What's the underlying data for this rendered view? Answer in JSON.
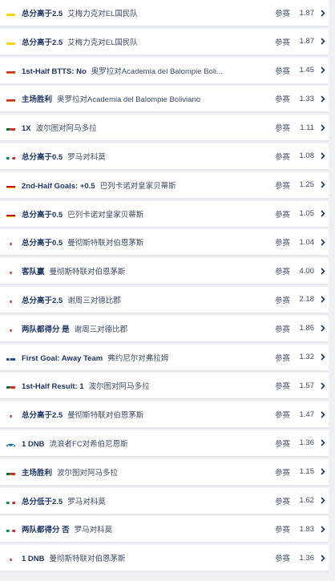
{
  "bets": [
    {
      "flag": "co",
      "market": "总分高于2.5",
      "event": "艾梅力克对EL国民队",
      "join": "参赛",
      "odds": "1.87"
    },
    {
      "flag": "co",
      "market": "总分高于2.5",
      "event": "艾梅力克对EL国民队",
      "join": "参赛",
      "odds": "1.87"
    },
    {
      "flag": "bo",
      "market": "1st-Half BTTS: No",
      "event": "奥罗拉对Academia del Balompie Boli...",
      "join": "参赛",
      "odds": "1.45"
    },
    {
      "flag": "bo",
      "market": "主场胜利",
      "event": "奥罗拉对Academia del Balompie Boliviano",
      "join": "参赛",
      "odds": "1.33"
    },
    {
      "flag": "pt",
      "market": "1X",
      "event": "波尔图对阿马多拉",
      "join": "参赛",
      "odds": "1.11"
    },
    {
      "flag": "it",
      "market": "总分高于0.5",
      "event": "罗马对科莫",
      "join": "参赛",
      "odds": "1.08"
    },
    {
      "flag": "es",
      "market": "2nd-Half Goals: +0.5",
      "event": "巴列卡诺对皇家贝蒂斯",
      "join": "参赛",
      "odds": "1.25"
    },
    {
      "flag": "es",
      "market": "总分高于0.5",
      "event": "巴列卡诺对皇家贝蒂斯",
      "join": "参赛",
      "odds": "1.05"
    },
    {
      "flag": "en",
      "market": "总分高于0.5",
      "event": "曼彻斯特联对伯恩茅斯",
      "join": "参赛",
      "odds": "1.04"
    },
    {
      "flag": "en",
      "market": "客队赢",
      "event": "曼彻斯特联对伯恩茅斯",
      "join": "参赛",
      "odds": "4.00"
    },
    {
      "flag": "en",
      "market": "总分高于2.5",
      "event": "谢周三对德比郡",
      "join": "参赛",
      "odds": "2.18"
    },
    {
      "flag": "en",
      "market": "两队都得分 是",
      "event": "谢周三对德比郡",
      "join": "参赛",
      "odds": "1.86"
    },
    {
      "flag": "is",
      "market": "First Goal: Away Team",
      "event": "弗约尼尔对弗拉姆",
      "join": "参赛",
      "odds": "1.32"
    },
    {
      "flag": "pt",
      "market": "1st-Half Result: 1",
      "event": "波尔图对阿马多拉",
      "join": "参赛",
      "odds": "1.57"
    },
    {
      "flag": "en",
      "market": "总分高于2.5",
      "event": "曼彻斯特联对伯恩茅斯",
      "join": "参赛",
      "odds": "1.47"
    },
    {
      "flag": "sc",
      "market": "1 DNB",
      "event": "流浪者FC对希伯尼恩斯",
      "join": "参赛",
      "odds": "1.36"
    },
    {
      "flag": "pt",
      "market": "主场胜利",
      "event": "波尔图对阿马多拉",
      "join": "参赛",
      "odds": "1.15"
    },
    {
      "flag": "it",
      "market": "总分低于2.5",
      "event": "罗马对科莫",
      "join": "参赛",
      "odds": "1.62"
    },
    {
      "flag": "it",
      "market": "两队都得分 否",
      "event": "罗马对科莫",
      "join": "参赛",
      "odds": "1.83"
    },
    {
      "flag": "en",
      "market": "1 DNB",
      "event": "曼彻斯特联对伯恩茅斯",
      "join": "参赛",
      "odds": "1.36"
    }
  ],
  "colors": {
    "market_text": "#1f3566",
    "row_bg": "#ffffff",
    "page_bg": "#eef0f4",
    "chevron": "#1f3566"
  }
}
